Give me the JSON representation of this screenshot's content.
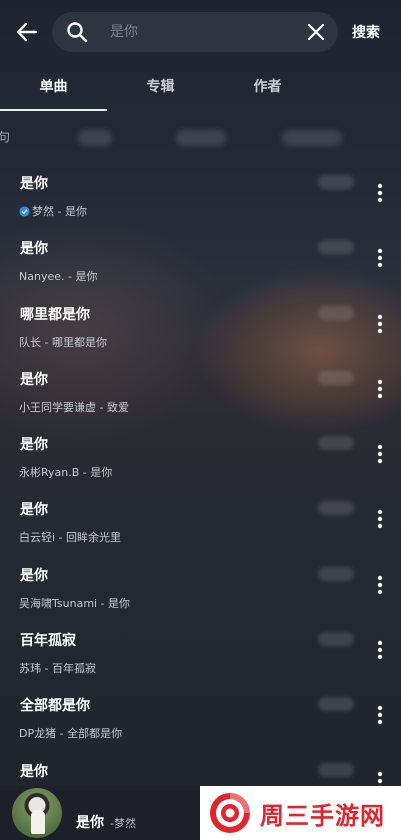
{
  "header": {
    "search_placeholder": "是你",
    "search_button": "搜索"
  },
  "tabs": [
    {
      "label": "单曲",
      "active": true
    },
    {
      "label": "专辑",
      "active": false
    },
    {
      "label": "作者",
      "active": false
    }
  ],
  "filter_edge_text": "句",
  "songs": [
    {
      "title": "是你",
      "subtitle": "梦然 - 是你",
      "verified": true
    },
    {
      "title": "是你",
      "subtitle": "Nanyee. - 是你",
      "verified": false
    },
    {
      "title": "哪里都是你",
      "subtitle": "队长 - 哪里都是你",
      "verified": false
    },
    {
      "title": "是你",
      "subtitle": "小王同学要谦虚 - 致爱",
      "verified": false
    },
    {
      "title": "是你",
      "subtitle": "永彬Ryan.B - 是你",
      "verified": false
    },
    {
      "title": "是你",
      "subtitle": "白云轻i - 回眸余光里",
      "verified": false
    },
    {
      "title": "是你",
      "subtitle": "吴海啸Tsunami - 是你",
      "verified": false
    },
    {
      "title": "百年孤寂",
      "subtitle": "苏玮 - 百年孤寂",
      "verified": false
    },
    {
      "title": "全部都是你",
      "subtitle": "DP龙猪 - 全部都是你",
      "verified": false
    },
    {
      "title": "是你",
      "subtitle": "",
      "verified": false
    }
  ],
  "player": {
    "title": "是你",
    "artist": "-梦然"
  },
  "watermark": {
    "text": "周三手游网",
    "color": "#e2242c"
  },
  "colors": {
    "accent_badge": "#2f8de4"
  }
}
